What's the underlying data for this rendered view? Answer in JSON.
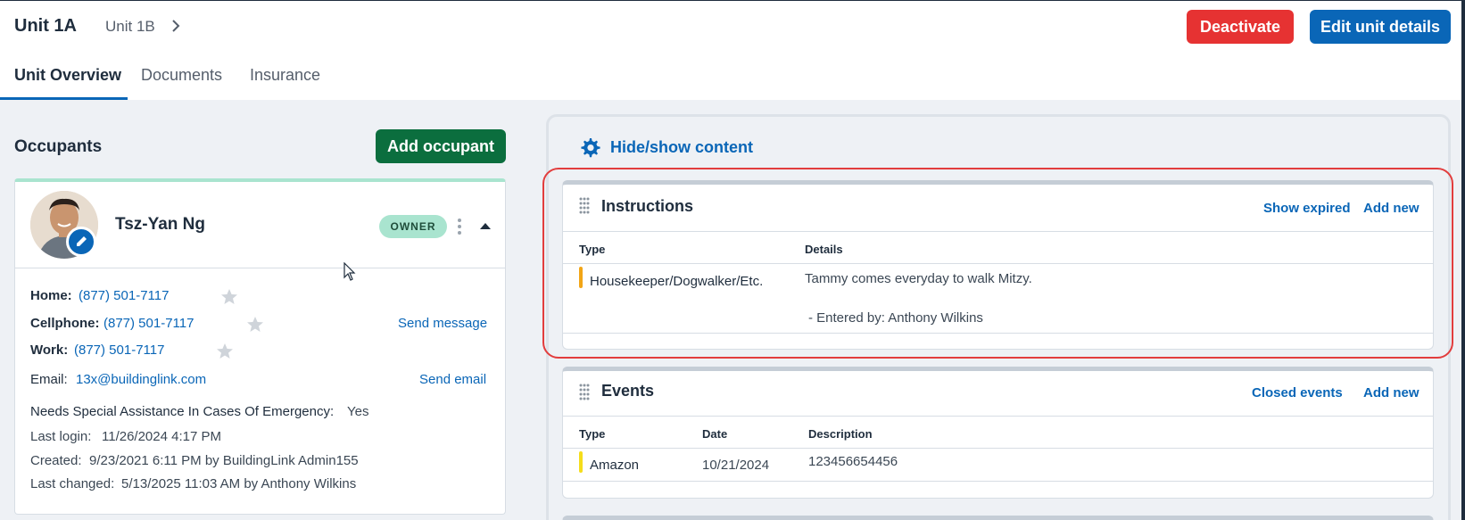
{
  "header": {
    "unit_title": "Unit 1A",
    "next_unit": "Unit 1B",
    "deactivate_label": "Deactivate",
    "edit_label": "Edit unit details"
  },
  "tabs": [
    {
      "label": "Unit Overview"
    },
    {
      "label": "Documents"
    },
    {
      "label": "Insurance"
    }
  ],
  "occupants": {
    "title": "Occupants",
    "add_label": "Add occupant",
    "person": {
      "name": "Tsz-Yan Ng",
      "role": "OWNER",
      "home_label": "Home:",
      "home": "(877) 501-7117",
      "cell_label": "Cellphone:",
      "cell": "(877) 501-7117",
      "work_label": "Work:",
      "work": "(877) 501-7117",
      "send_message": "Send message",
      "email_label": "Email:",
      "email": "13x@buildinglink.com",
      "send_email": "Send email",
      "assist_label": "Needs Special Assistance In Cases Of Emergency:",
      "assist_value": "Yes",
      "last_login_label": "Last login:",
      "last_login": "11/26/2024 4:17 PM",
      "created_label": "Created:",
      "created": "9/23/2021 6:11 PM by BuildingLink Admin155",
      "changed_label": "Last changed:",
      "changed": "5/13/2025 11:03 AM by Anthony Wilkins"
    }
  },
  "panel": {
    "hide_show": "Hide/show content",
    "instructions": {
      "title": "Instructions",
      "show_expired": "Show expired",
      "add_new": "Add new",
      "col_type": "Type",
      "col_details": "Details",
      "rows": [
        {
          "type": "Housekeeper/Dogwalker/Etc.",
          "details": "Tammy comes everyday to walk Mitzy.",
          "entered_by": "- Entered by: Anthony Wilkins",
          "bar_color": "#f2a516"
        }
      ]
    },
    "events": {
      "title": "Events",
      "closed": "Closed events",
      "add_new": "Add new",
      "col_type": "Type",
      "col_date": "Date",
      "col_desc": "Description",
      "rows": [
        {
          "type": "Amazon",
          "date": "10/21/2024",
          "description": "123456654456",
          "bar_color": "#f5dd1a"
        }
      ]
    }
  },
  "colors": {
    "accent_blue": "#0a66b7",
    "danger_red": "#e63232",
    "success_green": "#0b6e3e",
    "owner_badge": "#a9e4cf"
  }
}
